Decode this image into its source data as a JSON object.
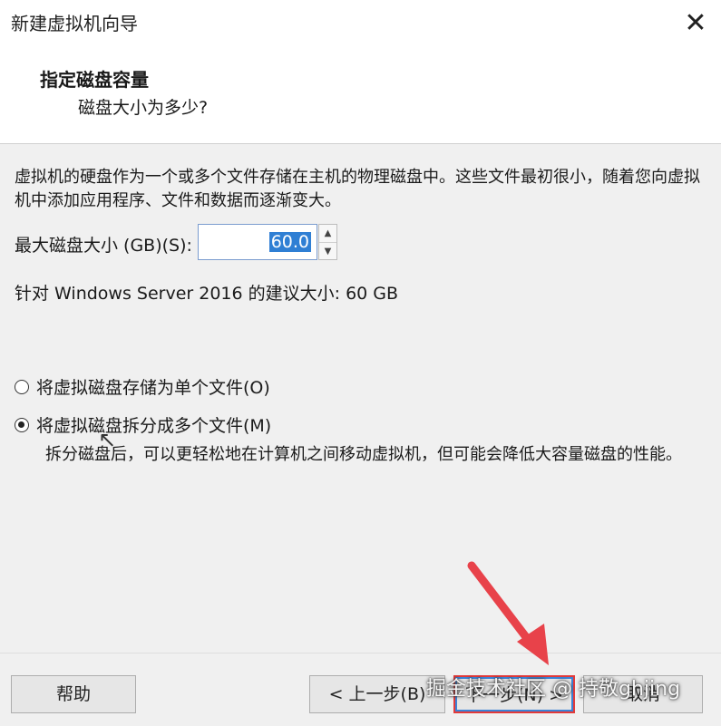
{
  "window": {
    "title": "新建虚拟机向导",
    "close_glyph": "✕"
  },
  "header": {
    "title": "指定磁盘容量",
    "subtitle": "磁盘大小为多少?"
  },
  "content": {
    "description": "虚拟机的硬盘作为一个或多个文件存储在主机的物理磁盘中。这些文件最初很小，随着您向虚拟机中添加应用程序、文件和数据而逐渐变大。",
    "size_label": "最大磁盘大小 (GB)(S):",
    "size_value": "60.0",
    "recommendation": "针对 Windows Server 2016 的建议大小: 60 GB",
    "options": [
      {
        "label": "将虚拟磁盘存储为单个文件(O)",
        "selected": false
      },
      {
        "label": "将虚拟磁盘拆分成多个文件(M)",
        "selected": true
      }
    ],
    "split_note": "拆分磁盘后，可以更轻松地在计算机之间移动虚拟机，但可能会降低大容量磁盘的性能。"
  },
  "footer": {
    "help_label": "帮助",
    "back_label": "< 上一步(B)",
    "next_label": "下一步(N) >",
    "cancel_label": "取消"
  },
  "overlay": {
    "watermark": "掘金技术社区 @ 持敬ghjing",
    "arrow_color": "#e8424a",
    "highlight_color": "#e23a3a"
  }
}
